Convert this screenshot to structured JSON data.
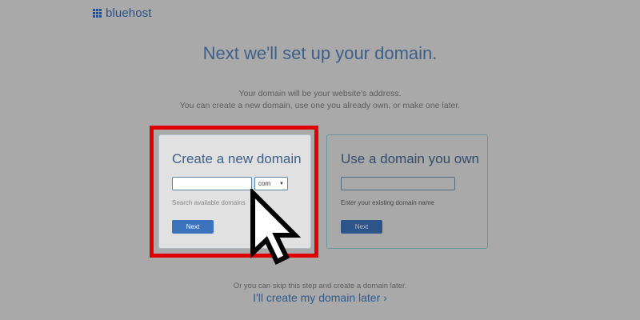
{
  "brand": {
    "name": "bluehost",
    "color": "#2a4f86",
    "icon": "grid-logo-icon"
  },
  "headline": "Next we'll set up your domain.",
  "subtitle": {
    "line1": "Your domain will be your website's address.",
    "line2": "You can create a new domain, use one you already own, or make one later."
  },
  "new_domain": {
    "title": "Create a new domain",
    "input_value": "",
    "tld_selected": "com",
    "hint": "Search available domains",
    "button_label": "Next",
    "highlight_color": "#e10000"
  },
  "own_domain": {
    "title": "Use a domain you own",
    "input_value": "",
    "hint": "Enter your existing domain name",
    "button_label": "Next"
  },
  "skip": {
    "note": "Or you can skip this step and create a domain later.",
    "link_label": "I'll create my domain later",
    "link_icon": "chevron-right-icon"
  },
  "overlay": {
    "cursor_icon": "pointer-arrow-icon"
  },
  "colors": {
    "accent": "#3c73bd",
    "heading": "#3e5f8a",
    "background": "#a9a9a9"
  }
}
